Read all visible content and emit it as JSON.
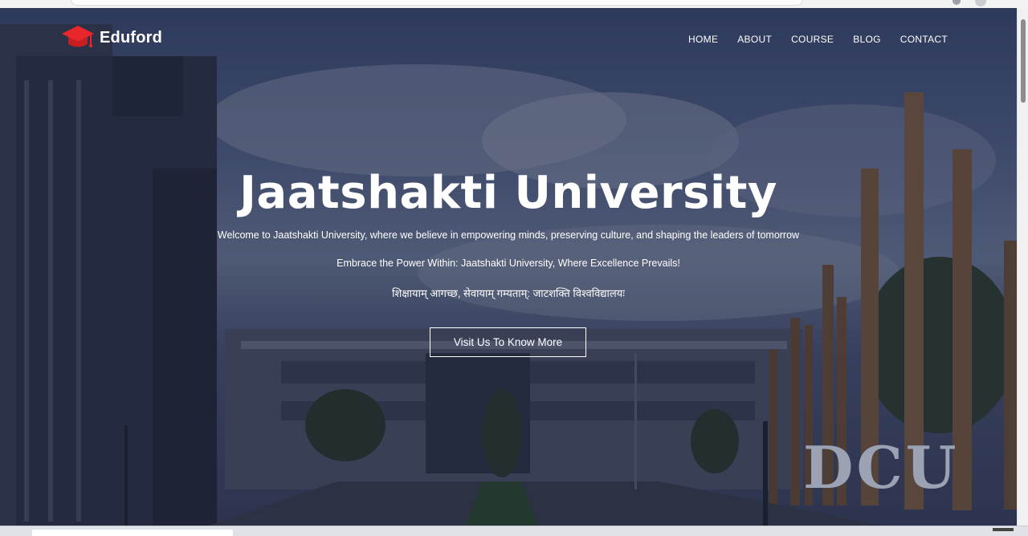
{
  "brand": {
    "name": "Eduford",
    "logo_icon": "graduation-cap-icon",
    "accent": "#e8262b"
  },
  "nav": {
    "items": [
      {
        "label": "HOME"
      },
      {
        "label": "ABOUT"
      },
      {
        "label": "COURSE"
      },
      {
        "label": "BLOG"
      },
      {
        "label": "CONTACT"
      }
    ]
  },
  "hero": {
    "title": "Jaatshakti University",
    "subtitle": "Welcome to Jaatshakti University, where we believe in empowering minds, preserving culture, and shaping the leaders of tomorrow",
    "tagline": "Embrace the Power Within: Jaatshakti University, Where Excellence Prevails!",
    "motto": "शिक्षायाम् आगच्छ, सेवायाम् गम्यताम्: जाटशक्ति विश्वविद्यालयः",
    "cta_label": "Visit Us To Know More",
    "background_sign_text": "DCU"
  }
}
